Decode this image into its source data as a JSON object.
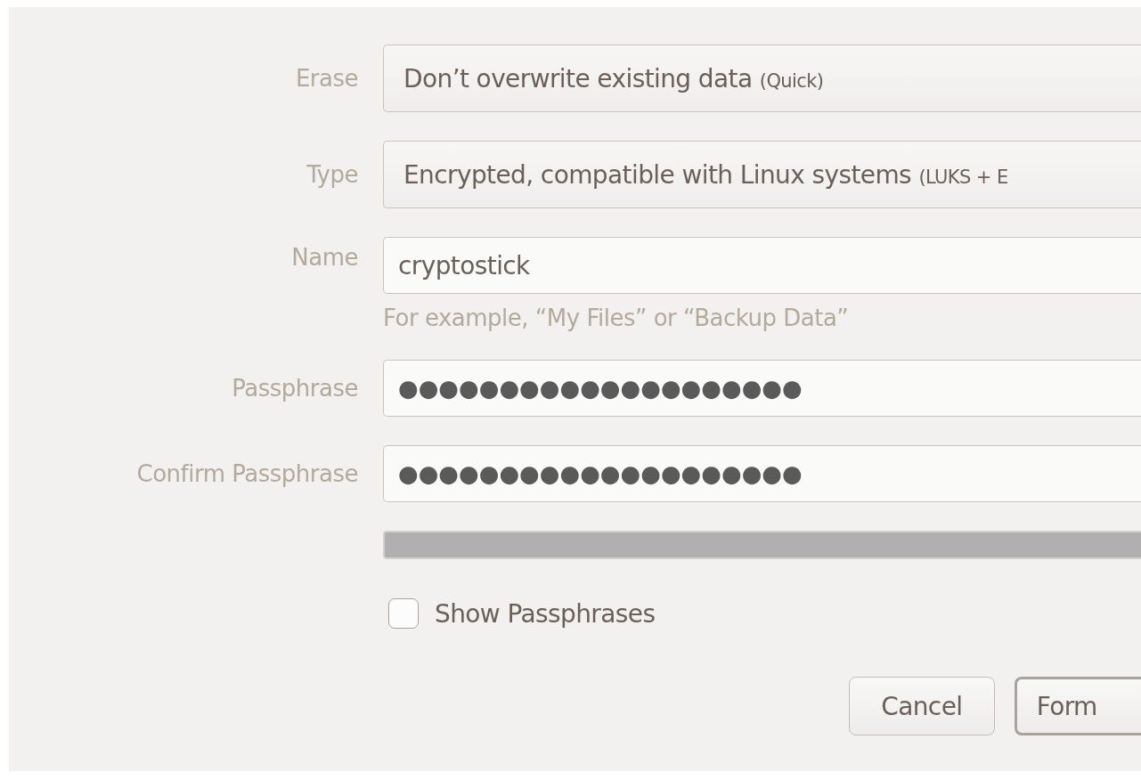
{
  "form": {
    "erase": {
      "label": "Erase",
      "value": "Don’t overwrite existing data",
      "detail": "(Quick)"
    },
    "type": {
      "label": "Type",
      "value": "Encrypted, compatible with Linux systems",
      "detail": "(LUKS + E"
    },
    "name": {
      "label": "Name",
      "value": "cryptostick",
      "hint": "For example, “My Files” or “Backup Data”"
    },
    "passphrase": {
      "label": "Passphrase",
      "value": "●●●●●●●●●●●●●●●●●●●●"
    },
    "confirm": {
      "label": "Confirm Passphrase",
      "value": "●●●●●●●●●●●●●●●●●●●●"
    },
    "strength": {
      "level": 0
    },
    "show_passphrases": {
      "label": "Show Passphrases",
      "checked": false
    }
  },
  "buttons": [
    {
      "label": "Cancel",
      "default": false
    },
    {
      "label": "Form",
      "default": true
    }
  ]
}
